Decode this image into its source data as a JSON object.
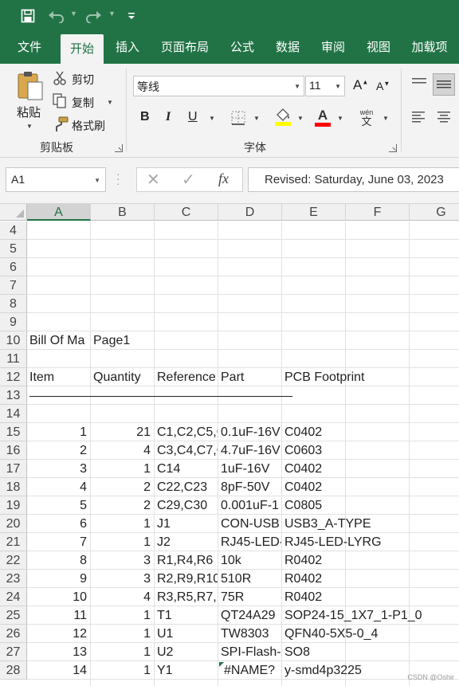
{
  "quick_access": {
    "icons": [
      "save-icon",
      "undo-icon",
      "redo-icon",
      "customize-icon"
    ]
  },
  "tabs": [
    {
      "label": "文件",
      "active": false
    },
    {
      "label": "开始",
      "active": true
    },
    {
      "label": "插入",
      "active": false
    },
    {
      "label": "页面布局",
      "active": false
    },
    {
      "label": "公式",
      "active": false
    },
    {
      "label": "数据",
      "active": false
    },
    {
      "label": "审阅",
      "active": false
    },
    {
      "label": "视图",
      "active": false
    },
    {
      "label": "加载项",
      "active": false
    }
  ],
  "ribbon": {
    "clipboard": {
      "paste_label": "粘贴",
      "cut_label": "剪切",
      "copy_label": "复制",
      "format_painter_label": "格式刷",
      "group_label": "剪贴板"
    },
    "font": {
      "font_name": "等线",
      "font_size": "11",
      "grow_label": "A",
      "shrink_label": "A",
      "bold_label": "B",
      "italic_label": "I",
      "underline_label": "U",
      "font_color_label": "A",
      "phonetic_label": "wén",
      "group_label": "字体",
      "fill_color": "#ffff00",
      "font_color": "#ff0000"
    }
  },
  "formula_bar": {
    "name_box": "A1",
    "fx_label": "fx",
    "content": "Revised: Saturday, June 03, 2023"
  },
  "sheet": {
    "columns": [
      "A",
      "B",
      "C",
      "D",
      "E",
      "F",
      "G"
    ],
    "selected_column": "A",
    "rows": [
      {
        "num": "4"
      },
      {
        "num": "5"
      },
      {
        "num": "6"
      },
      {
        "num": "7"
      },
      {
        "num": "8"
      },
      {
        "num": "9"
      },
      {
        "num": "10",
        "A": "Bill Of Ma",
        "B": "Page1"
      },
      {
        "num": "11"
      },
      {
        "num": "12",
        "A": "Item",
        "B": "Quantity",
        "C": "Reference",
        "D": "Part",
        "E": "PCB Footprint"
      },
      {
        "num": "13",
        "underline": "______________________________________________"
      },
      {
        "num": "14"
      },
      {
        "num": "15",
        "A": "1",
        "B": "21",
        "C": "C1,C2,C5,C",
        "D": "0.1uF-16V",
        "E": "C0402"
      },
      {
        "num": "16",
        "A": "2",
        "B": "4",
        "C": "C3,C4,C7,C",
        "D": "4.7uF-16V",
        "E": "C0603"
      },
      {
        "num": "17",
        "A": "3",
        "B": "1",
        "C": "C14",
        "D": "1uF-16V",
        "E": "C0402"
      },
      {
        "num": "18",
        "A": "4",
        "B": "2",
        "C": "C22,C23",
        "D": "8pF-50V",
        "E": "C0402"
      },
      {
        "num": "19",
        "A": "5",
        "B": "2",
        "C": "C29,C30",
        "D": "0.001uF-1",
        "E": "C0805"
      },
      {
        "num": "20",
        "A": "6",
        "B": "1",
        "C": "J1",
        "D": "CON-USB",
        "E": "USB3_A-TYPE"
      },
      {
        "num": "21",
        "A": "7",
        "B": "1",
        "C": "J2",
        "D": "RJ45-LED-",
        "E": "RJ45-LED-LYRG"
      },
      {
        "num": "22",
        "A": "8",
        "B": "3",
        "C": "R1,R4,R6",
        "D": "10k",
        "E": "R0402"
      },
      {
        "num": "23",
        "A": "9",
        "B": "3",
        "C": "R2,R9,R10",
        "D": "510R",
        "E": "R0402"
      },
      {
        "num": "24",
        "A": "10",
        "B": "4",
        "C": "R3,R5,R7,R",
        "D": "75R",
        "E": "R0402"
      },
      {
        "num": "25",
        "A": "11",
        "B": "1",
        "C": "T1",
        "D": "QT24A29",
        "E": "SOP24-15_1X7_1-P1_0"
      },
      {
        "num": "26",
        "A": "12",
        "B": "1",
        "C": "U1",
        "D": "TW8303",
        "E": "QFN40-5X5-0_4"
      },
      {
        "num": "27",
        "A": "13",
        "B": "1",
        "C": "U2",
        "D": "SPI-Flash-",
        "E": "SO8"
      },
      {
        "num": "28",
        "A": "14",
        "B": "1",
        "C": "Y1",
        "D": "#NAME?",
        "E": "y-smd4p3225",
        "error_D": true
      }
    ]
  },
  "watermark": "CSDN @Oshir"
}
